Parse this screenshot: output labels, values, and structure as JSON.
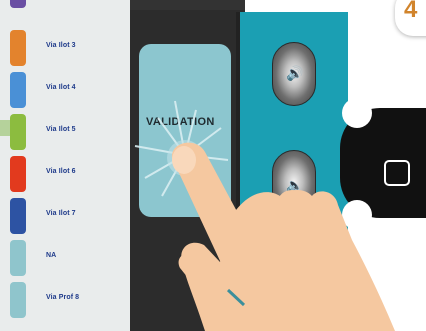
{
  "list": {
    "items": [
      {
        "label": "Via Ilot 3",
        "color": "#e3832d"
      },
      {
        "label": "Via Ilot 4",
        "color": "#4a90d6"
      },
      {
        "label": "Via Ilot 5",
        "color": "#8cbc3f"
      },
      {
        "label": "Via Ilot 6",
        "color": "#e23a1e"
      },
      {
        "label": "Via Ilot 7",
        "color": "#2d53a3"
      },
      {
        "label": "NA",
        "color": "#8fc5cc"
      },
      {
        "label": "Via Prof 8",
        "color": "#8fc5cc"
      }
    ]
  },
  "validation": {
    "label": "VALIDATION"
  },
  "speakers": {
    "up_icon": "volume-up-icon",
    "down_icon": "volume-down-icon"
  },
  "home_button_icon": "home-square-icon",
  "badge": {
    "number": "4"
  },
  "colors": {
    "teal": "#1b9fb3",
    "validation_button": "#8cc6cf",
    "dark_body": "#2c2c2c",
    "skin": "#f5c8a0"
  }
}
